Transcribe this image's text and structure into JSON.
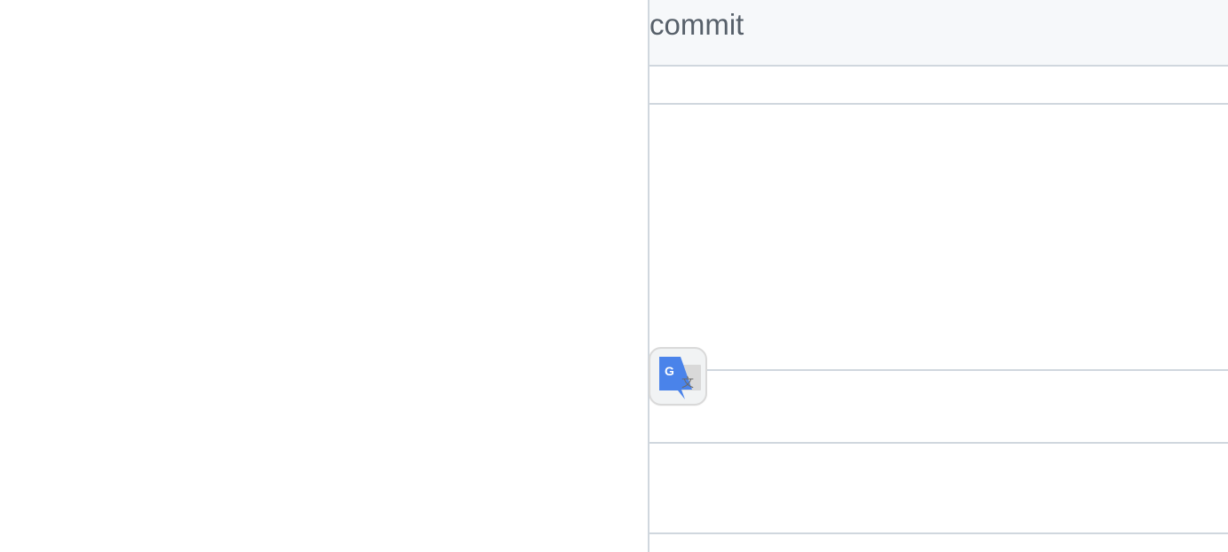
{
  "header": {
    "title": "commit"
  },
  "translate_widget": {
    "icon": "google-translate-icon",
    "glyph_g": "G",
    "glyph_wen": "文",
    "colors": {
      "blue": "#4a83ea",
      "gray": "#d9d9d9",
      "dark_gray": "#6b6b6b",
      "border": "#d9d9d9",
      "background": "#f1f3f4"
    }
  },
  "colors": {
    "panel_border": "#d0d7de",
    "header_background": "#f6f8fa",
    "header_text": "#57606a"
  }
}
